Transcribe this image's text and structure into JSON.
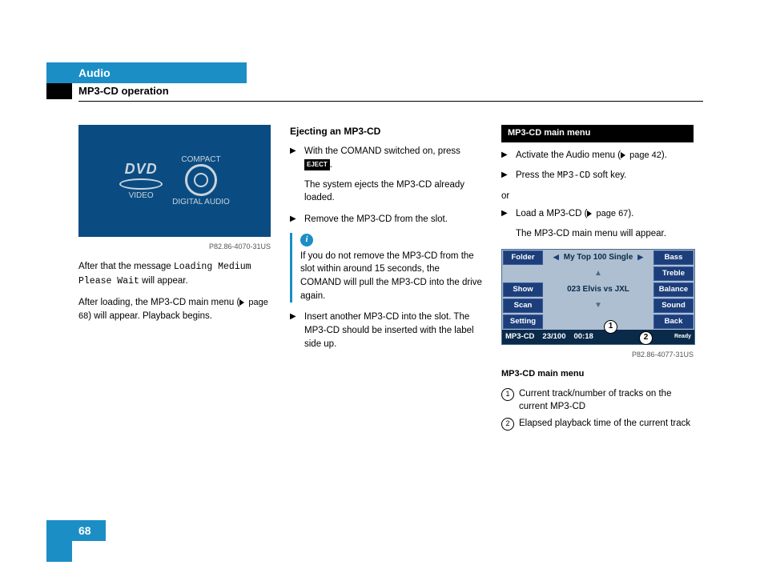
{
  "header": {
    "chapter": "Audio",
    "section": "MP3-CD operation",
    "page_number": "68"
  },
  "col1": {
    "panel_logo_dvd_top": "DVD",
    "panel_logo_dvd_bottom": "VIDEO",
    "panel_logo_disc_top": "COMPACT",
    "panel_logo_disc_mid": "disc",
    "panel_logo_disc_bottom": "DIGITAL AUDIO",
    "img_caption": "P82.86-4070-31US",
    "para1_a": "After that the message ",
    "para1_mono": "Loading Medium Please Wait",
    "para1_b": " will appear.",
    "para2_a": "After loading, the MP3-CD main menu (",
    "para2_ref": " page 68",
    "para2_b": ") will appear. Playback begins."
  },
  "col2": {
    "heading": "Ejecting an MP3-CD",
    "b1_a": "With the COMAND switched on, press ",
    "b1_badge": "EJECT",
    "b1_b": ".",
    "b1_follow": "The system ejects the MP3-CD already loaded.",
    "b2": "Remove the MP3-CD from the slot.",
    "info_i": "i",
    "info_text": "If you do not remove the MP3-CD from the slot within around 15 seconds, the COMAND will pull the MP3-CD into the drive again.",
    "b3": "Insert another MP3-CD into the slot. The MP3-CD should be inserted with the label side up."
  },
  "col3": {
    "bar_heading": "MP3-CD main menu",
    "b1_a": "Activate the Audio menu (",
    "b1_ref": " page 42",
    "b1_b": ").",
    "b2_a": "Press the ",
    "b2_mono": "MP3-CD",
    "b2_b": " soft key.",
    "or": "or",
    "b3_a": "Load a MP3-CD (",
    "b3_ref": " page 67",
    "b3_b": ").",
    "b3_follow": "The MP3-CD main menu will appear.",
    "screen": {
      "left_keys": [
        "Folder",
        "Show",
        "Scan",
        "Setting"
      ],
      "right_keys": [
        "Bass",
        "Treble",
        "Balance",
        "Sound",
        "Back"
      ],
      "top_center": "My Top 100 Single",
      "track_line": "023 Elvis vs JXL",
      "status_source": "MP3-CD",
      "status_track": "23/100",
      "status_time": "00:18",
      "status_ready": "Ready"
    },
    "img_caption": "P82.86-4077-31US",
    "legend_heading": "MP3-CD main menu",
    "legend1": "Current track/number of tracks on the current MP3-CD",
    "legend2": "Elapsed playback time of the current track"
  },
  "chart_data": null
}
